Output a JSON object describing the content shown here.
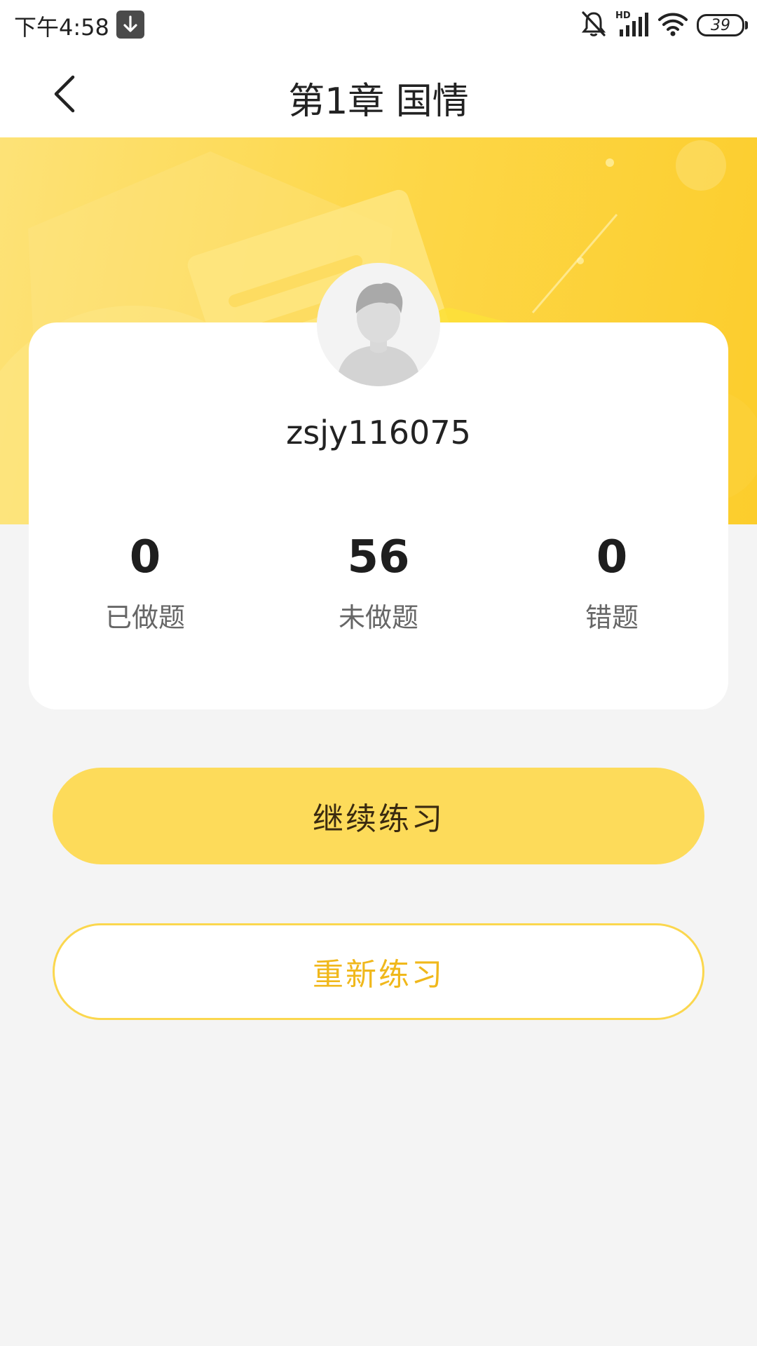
{
  "status_bar": {
    "time": "下午4:58",
    "battery": "39",
    "icons": [
      "download-icon",
      "mute-icon",
      "hd-signal-icon",
      "wifi-icon",
      "battery-icon"
    ],
    "hd_label": "HD"
  },
  "header": {
    "title": "第1章 国情",
    "back_icon": "chevron-left-icon"
  },
  "profile": {
    "username": "zsjy116075",
    "avatar_icon": "default-user-avatar-icon"
  },
  "stats": [
    {
      "value": "0",
      "label": "已做题"
    },
    {
      "value": "56",
      "label": "未做题"
    },
    {
      "value": "0",
      "label": "错题"
    }
  ],
  "actions": {
    "continue_label": "继续练习",
    "restart_label": "重新练习"
  },
  "colors": {
    "accent_yellow": "#fddb5a",
    "banner_yellow": "#fdd748",
    "restart_text": "#f0b81c",
    "background": "#f4f4f4"
  }
}
